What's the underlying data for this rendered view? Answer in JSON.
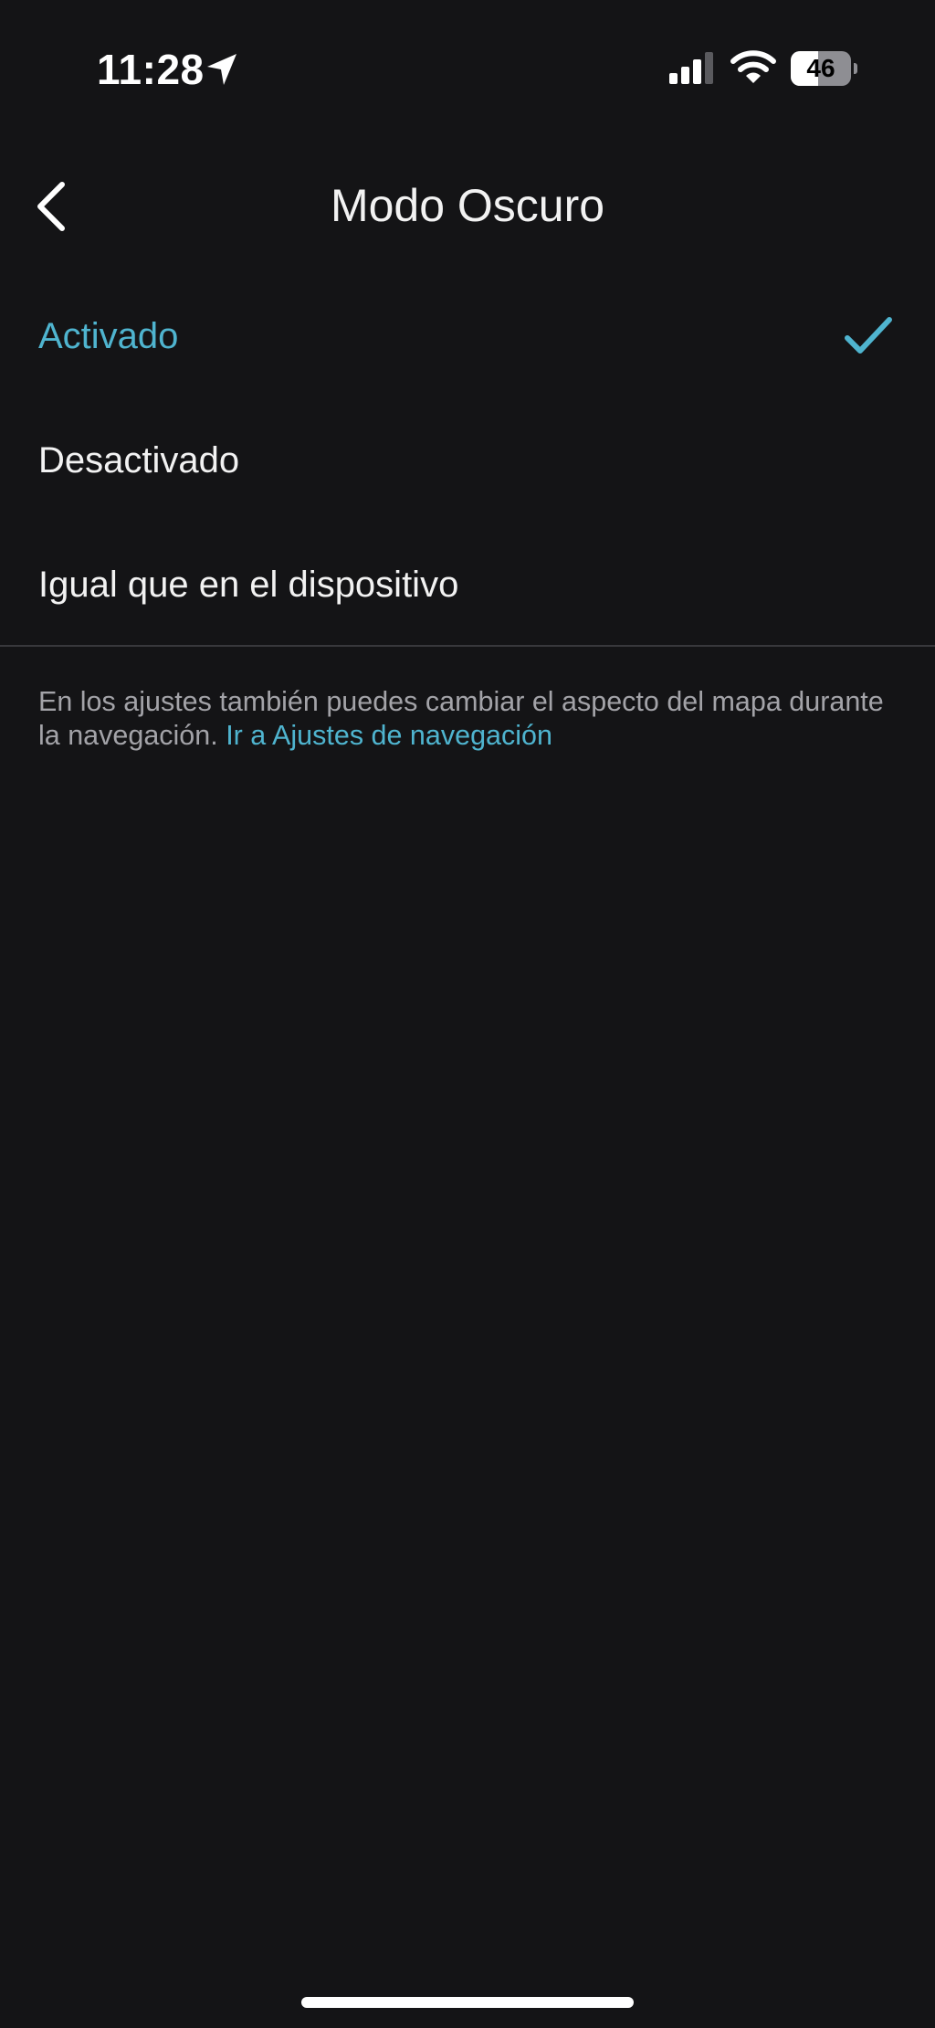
{
  "status_bar": {
    "time": "11:28",
    "battery_level": "46",
    "battery_fraction": 0.46,
    "icons": [
      "location-arrow-icon",
      "cellular-signal-icon",
      "wifi-icon",
      "battery-icon"
    ]
  },
  "header": {
    "title": "Modo Oscuro",
    "back_icon": "chevron-left-icon"
  },
  "options": [
    {
      "label": "Activado",
      "selected": true
    },
    {
      "label": "Desactivado",
      "selected": false
    },
    {
      "label": "Igual que en el dispositivo",
      "selected": false
    }
  ],
  "footer": {
    "note": "En los ajustes también puedes cambiar el aspecto del mapa durante la navegación.",
    "link": "Ir a Ajustes de navegación"
  },
  "colors": {
    "background": "#141416",
    "accent": "#4fb4cf",
    "text": "#f2f2f2",
    "secondary_text": "#a3a3a8"
  }
}
